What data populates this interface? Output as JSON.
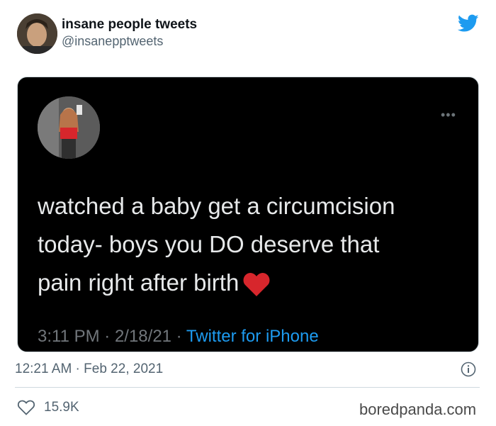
{
  "header": {
    "display_name": "insane people tweets",
    "handle": "@insanepptweets"
  },
  "embedded_tweet": {
    "text_line1": "watched a baby get a circumcision",
    "text_line2": "today- boys you DO deserve that",
    "text_line3": "pain right after birth",
    "time": "3:11 PM",
    "sep1": " · ",
    "date": "2/18/21",
    "sep2": " · ",
    "source": "Twitter for iPhone",
    "emoji": "red-heart",
    "more": "•••"
  },
  "footer": {
    "timestamp": "12:21 AM · Feb 22, 2021",
    "likes": "15.9K"
  },
  "watermark": "boredpanda.com",
  "colors": {
    "twitter_blue": "#1d9bf0",
    "heart_red": "#d7262c",
    "embed_bg": "#000000",
    "muted": "#536471"
  },
  "icons": [
    "twitter-bird-icon",
    "info-icon",
    "like-heart-icon",
    "more-dots-icon"
  ]
}
